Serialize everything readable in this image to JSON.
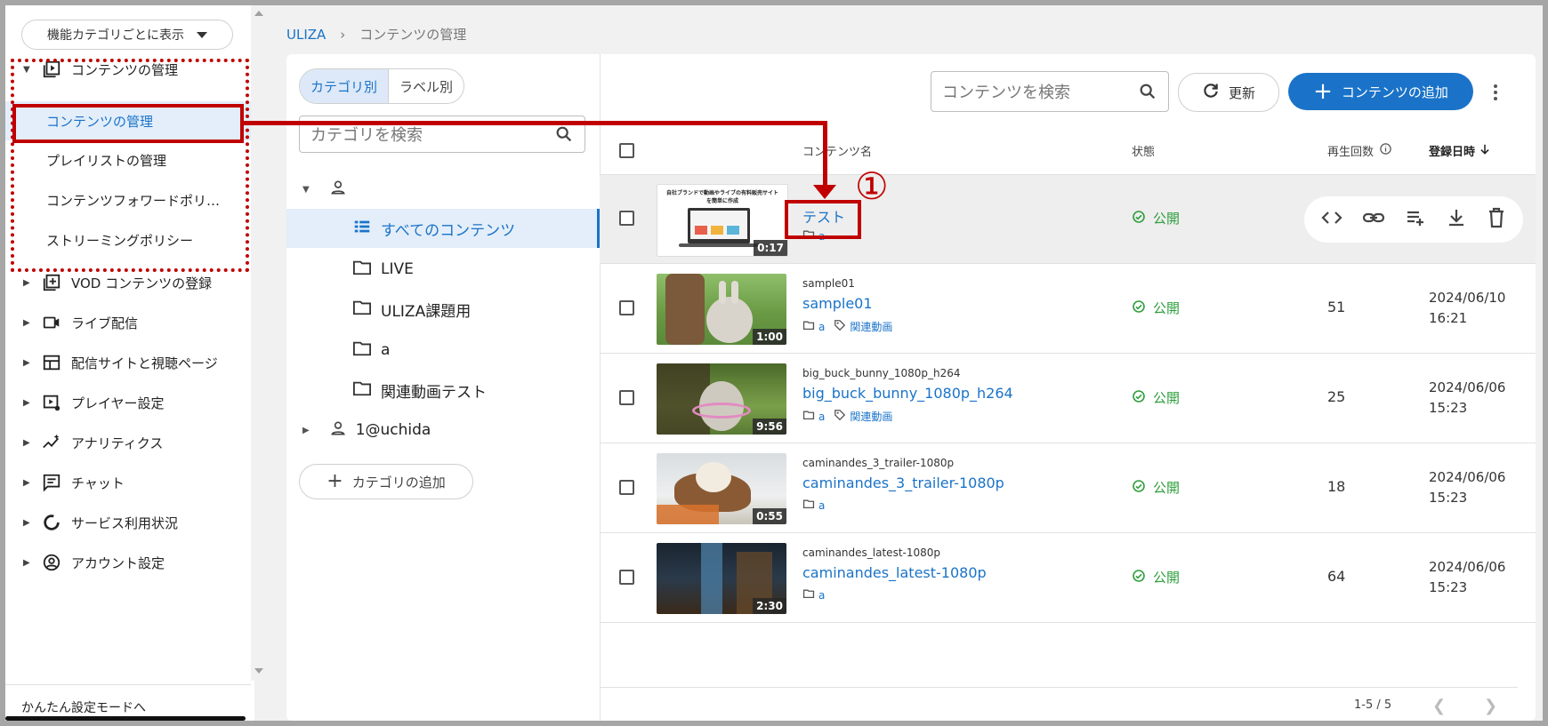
{
  "nav": {
    "category_button": "機能カテゴリごとに表示",
    "section_content": "コンテンツの管理",
    "sub_items": [
      "コンテンツの管理",
      "プレイリストの管理",
      "コンテンツフォワードポリ…",
      "ストリーミングポリシー"
    ],
    "items": [
      "VOD コンテンツの登録",
      "ライブ配信",
      "配信サイトと視聴ページ",
      "プレイヤー設定",
      "アナリティクス",
      "チャット",
      "サービス利用状況",
      "アカウント設定"
    ],
    "footer": "かんたん設定モードへ"
  },
  "breadcrumb": {
    "root": "ULIZA",
    "sep": "›",
    "current": "コンテンツの管理"
  },
  "categories": {
    "tabs": [
      "カテゴリ別",
      "ラベル別"
    ],
    "search_placeholder": "カテゴリを検索",
    "all": "すべてのコンテンツ",
    "folders": [
      "LIVE",
      "ULIZA課題用",
      "a",
      "関連動画テスト"
    ],
    "user2": "1@uchida",
    "add": "カテゴリの追加"
  },
  "toolbar": {
    "search_placeholder": "コンテンツを検索",
    "refresh": "更新",
    "add": "コンテンツの追加"
  },
  "table": {
    "headers": {
      "name": "コンテンツ名",
      "status": "状態",
      "plays": "再生回数",
      "date": "登録日時"
    },
    "rows": [
      {
        "id": "test",
        "title": "テスト",
        "tags": [
          "a"
        ],
        "status": "公開",
        "plays": "",
        "date": "",
        "time": "",
        "duration": "0:17"
      },
      {
        "id": "sample01",
        "title": "sample01",
        "tags": [
          "a",
          "関連動画"
        ],
        "status": "公開",
        "plays": "51",
        "date": "2024/06/10",
        "time": "16:21",
        "duration": "1:00"
      },
      {
        "id": "big_buck_bunny_1080p_h264",
        "title": "big_buck_bunny_1080p_h264",
        "tags": [
          "a",
          "関連動画"
        ],
        "status": "公開",
        "plays": "25",
        "date": "2024/06/06",
        "time": "15:23",
        "duration": "9:56"
      },
      {
        "id": "caminandes_3_trailer-1080p",
        "title": "caminandes_3_trailer-1080p",
        "tags": [
          "a"
        ],
        "status": "公開",
        "plays": "18",
        "date": "2024/06/06",
        "time": "15:23",
        "duration": "0:55"
      },
      {
        "id": "caminandes_latest-1080p",
        "title": "caminandes_latest-1080p",
        "tags": [
          "a"
        ],
        "status": "公開",
        "plays": "64",
        "date": "2024/06/06",
        "time": "15:23",
        "duration": "2:30"
      }
    ],
    "thumb_text": {
      "line1": "自社ブランドで動画やライブの有料販売サイト",
      "line2": "を簡単に作成"
    }
  },
  "pager": {
    "range": "1-5 / 5"
  },
  "annotation": {
    "step": "①"
  },
  "colors": {
    "accent": "#1a73c8",
    "annotation": "#c00000",
    "status": "#2e9e3c"
  }
}
